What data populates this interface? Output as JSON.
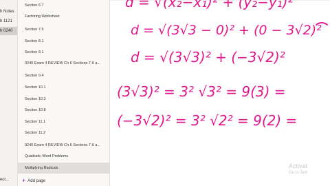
{
  "sections": [
    {
      "label": "h Notes",
      "active": false
    },
    {
      "label": "h 1121",
      "active": false
    },
    {
      "label": "h 0240",
      "active": true
    }
  ],
  "pages": [
    {
      "label": "Section 6.7",
      "active": false
    },
    {
      "label": "Factoring Worksheet",
      "active": false
    },
    {
      "label": "Section 7.6",
      "active": false
    },
    {
      "label": "Section 8.1",
      "active": false
    },
    {
      "label": "Section 9.1",
      "active": false
    },
    {
      "label": "0240  Exam 4 REVIEW Ch 6 Sections 7-6 a...",
      "active": false
    },
    {
      "label": "Section 9.4",
      "active": false
    },
    {
      "label": "Section 10.1",
      "active": false
    },
    {
      "label": "Section 10.3",
      "active": false
    },
    {
      "label": "Section 10.8",
      "active": false
    },
    {
      "label": "Section 11.1",
      "active": false
    },
    {
      "label": "Section 11.2",
      "active": false
    },
    {
      "label": "0240  Exam 4 REVIEW Ch 6 Sections 7-6 a...",
      "active": false
    },
    {
      "label": "Quadratic Word Problems",
      "active": false
    },
    {
      "label": "Multiplying Radicals",
      "active": true
    }
  ],
  "add_page_label": "Add page",
  "bottom_left_label": "ect...",
  "handwriting": {
    "line1": "d = √(x₂−x₁)² + (y₂−y₁)²",
    "line2": "d = √(3√3 − 0)² + (0 − 3√2)²",
    "line3": "d = √(3√3)² + (−3√2)²",
    "line4": "(3√3)² = 3² √3² = 9(3) =",
    "line5": "(−3√2)² = 3² √2² = 9(2) ="
  },
  "watermark": {
    "title": "Activat",
    "subtitle": "Go to Sett"
  },
  "colors": {
    "ink": "#e0188c",
    "accent": "#7719aa"
  }
}
